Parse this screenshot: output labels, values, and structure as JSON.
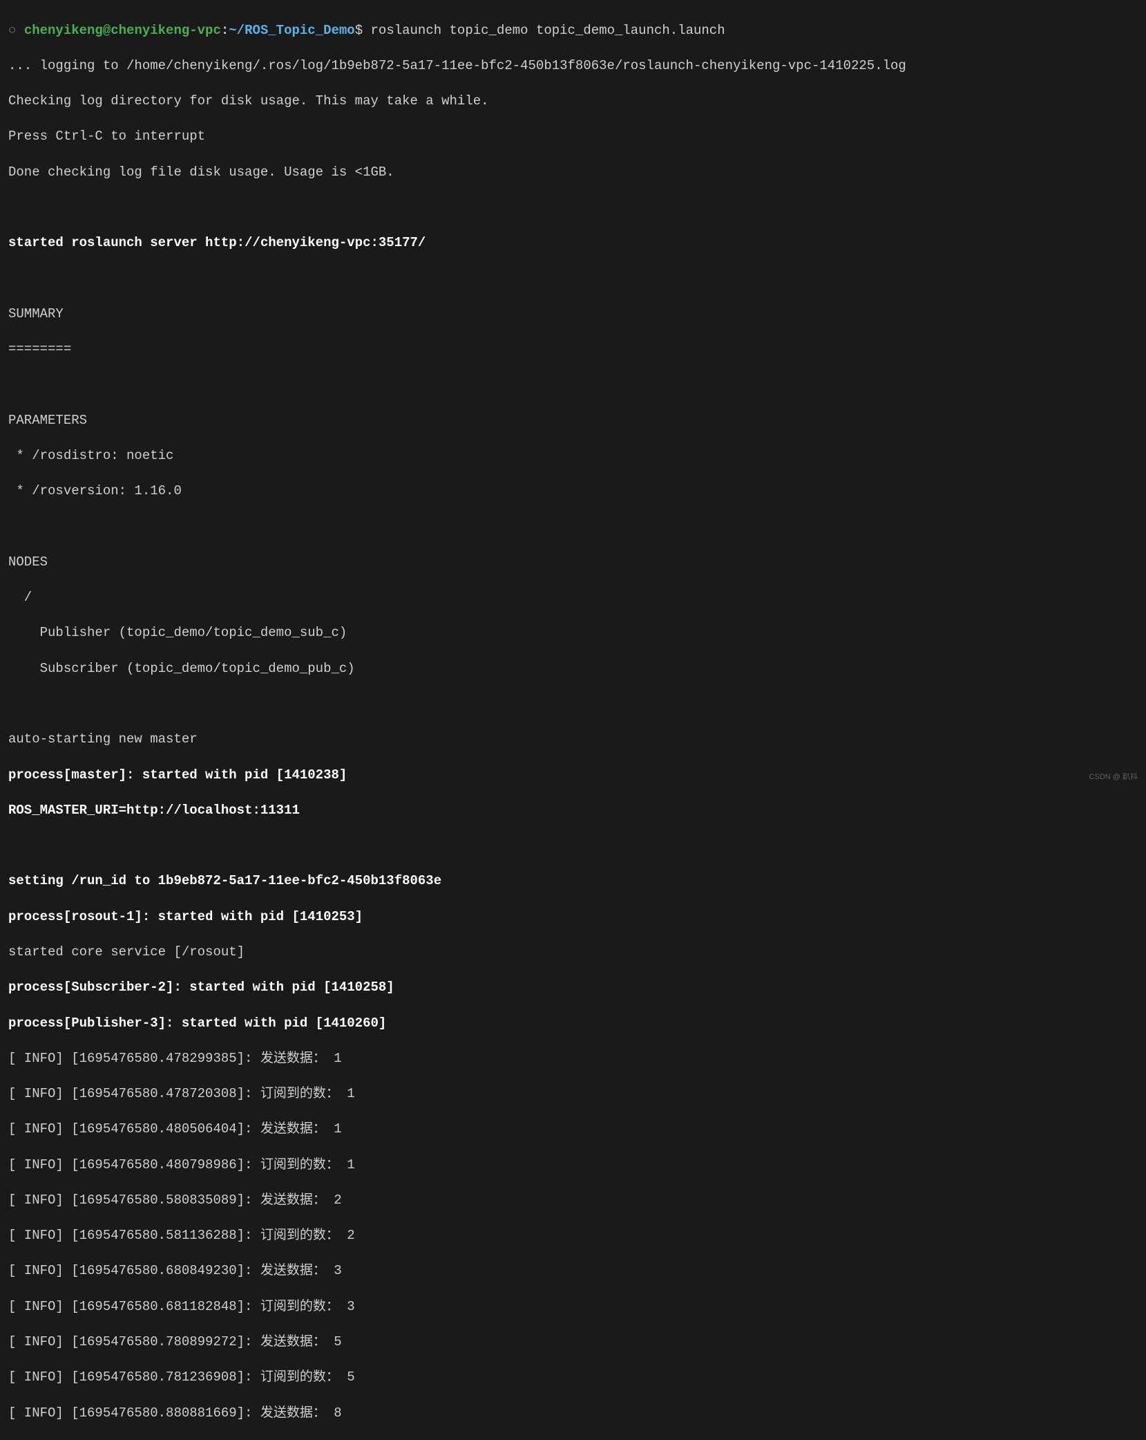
{
  "prompt": {
    "circle": "○",
    "user": "chenyikeng@chenyikeng-vpc",
    "colon": ":",
    "path": "~/ROS_Topic_Demo",
    "dollar": "$",
    "command": "roslaunch topic_demo topic_demo_launch.launch"
  },
  "init": {
    "logging": "... logging to /home/chenyikeng/.ros/log/1b9eb872-5a17-11ee-bfc2-450b13f8063e/roslaunch-chenyikeng-vpc-1410225.log",
    "checking": "Checking log directory for disk usage. This may take a while.",
    "press": "Press Ctrl-C to interrupt",
    "done": "Done checking log file disk usage. Usage is <1GB."
  },
  "started_server": "started roslaunch server http://chenyikeng-vpc:35177/",
  "summary": {
    "title": "SUMMARY",
    "sep": "========"
  },
  "parameters": {
    "title": "PARAMETERS",
    "rosdistro": " * /rosdistro: noetic",
    "rosversion": " * /rosversion: 1.16.0"
  },
  "nodes": {
    "title": "NODES",
    "slash": "  /",
    "publisher": "    Publisher (topic_demo/topic_demo_sub_c)",
    "subscriber": "    Subscriber (topic_demo/topic_demo_pub_c)"
  },
  "auto_starting": "auto-starting new master",
  "process_master": "process[master]: started with pid [1410238]",
  "ros_master_uri": "ROS_MASTER_URI=http://localhost:11311",
  "setting_run_id": "setting /run_id to 1b9eb872-5a17-11ee-bfc2-450b13f8063e",
  "process_rosout": "process[rosout-1]: started with pid [1410253]",
  "started_core": "started core service [/rosout]",
  "process_subscriber": "process[Subscriber-2]: started with pid [1410258]",
  "process_publisher": "process[Publisher-3]: started with pid [1410260]",
  "info_lines": [
    "[ INFO] [1695476580.478299385]: 发送数据： 1",
    "[ INFO] [1695476580.478720308]: 订阅到的数： 1",
    "[ INFO] [1695476580.480506404]: 发送数据： 1",
    "[ INFO] [1695476580.480798986]: 订阅到的数： 1",
    "[ INFO] [1695476580.580835089]: 发送数据： 2",
    "[ INFO] [1695476580.581136288]: 订阅到的数： 2",
    "[ INFO] [1695476580.680849230]: 发送数据： 3",
    "[ INFO] [1695476580.681182848]: 订阅到的数： 3",
    "[ INFO] [1695476580.780899272]: 发送数据： 5",
    "[ INFO] [1695476580.781236908]: 订阅到的数： 5",
    "[ INFO] [1695476580.880881669]: 发送数据： 8"
  ],
  "watermark": "CSDN @ 趴抖"
}
